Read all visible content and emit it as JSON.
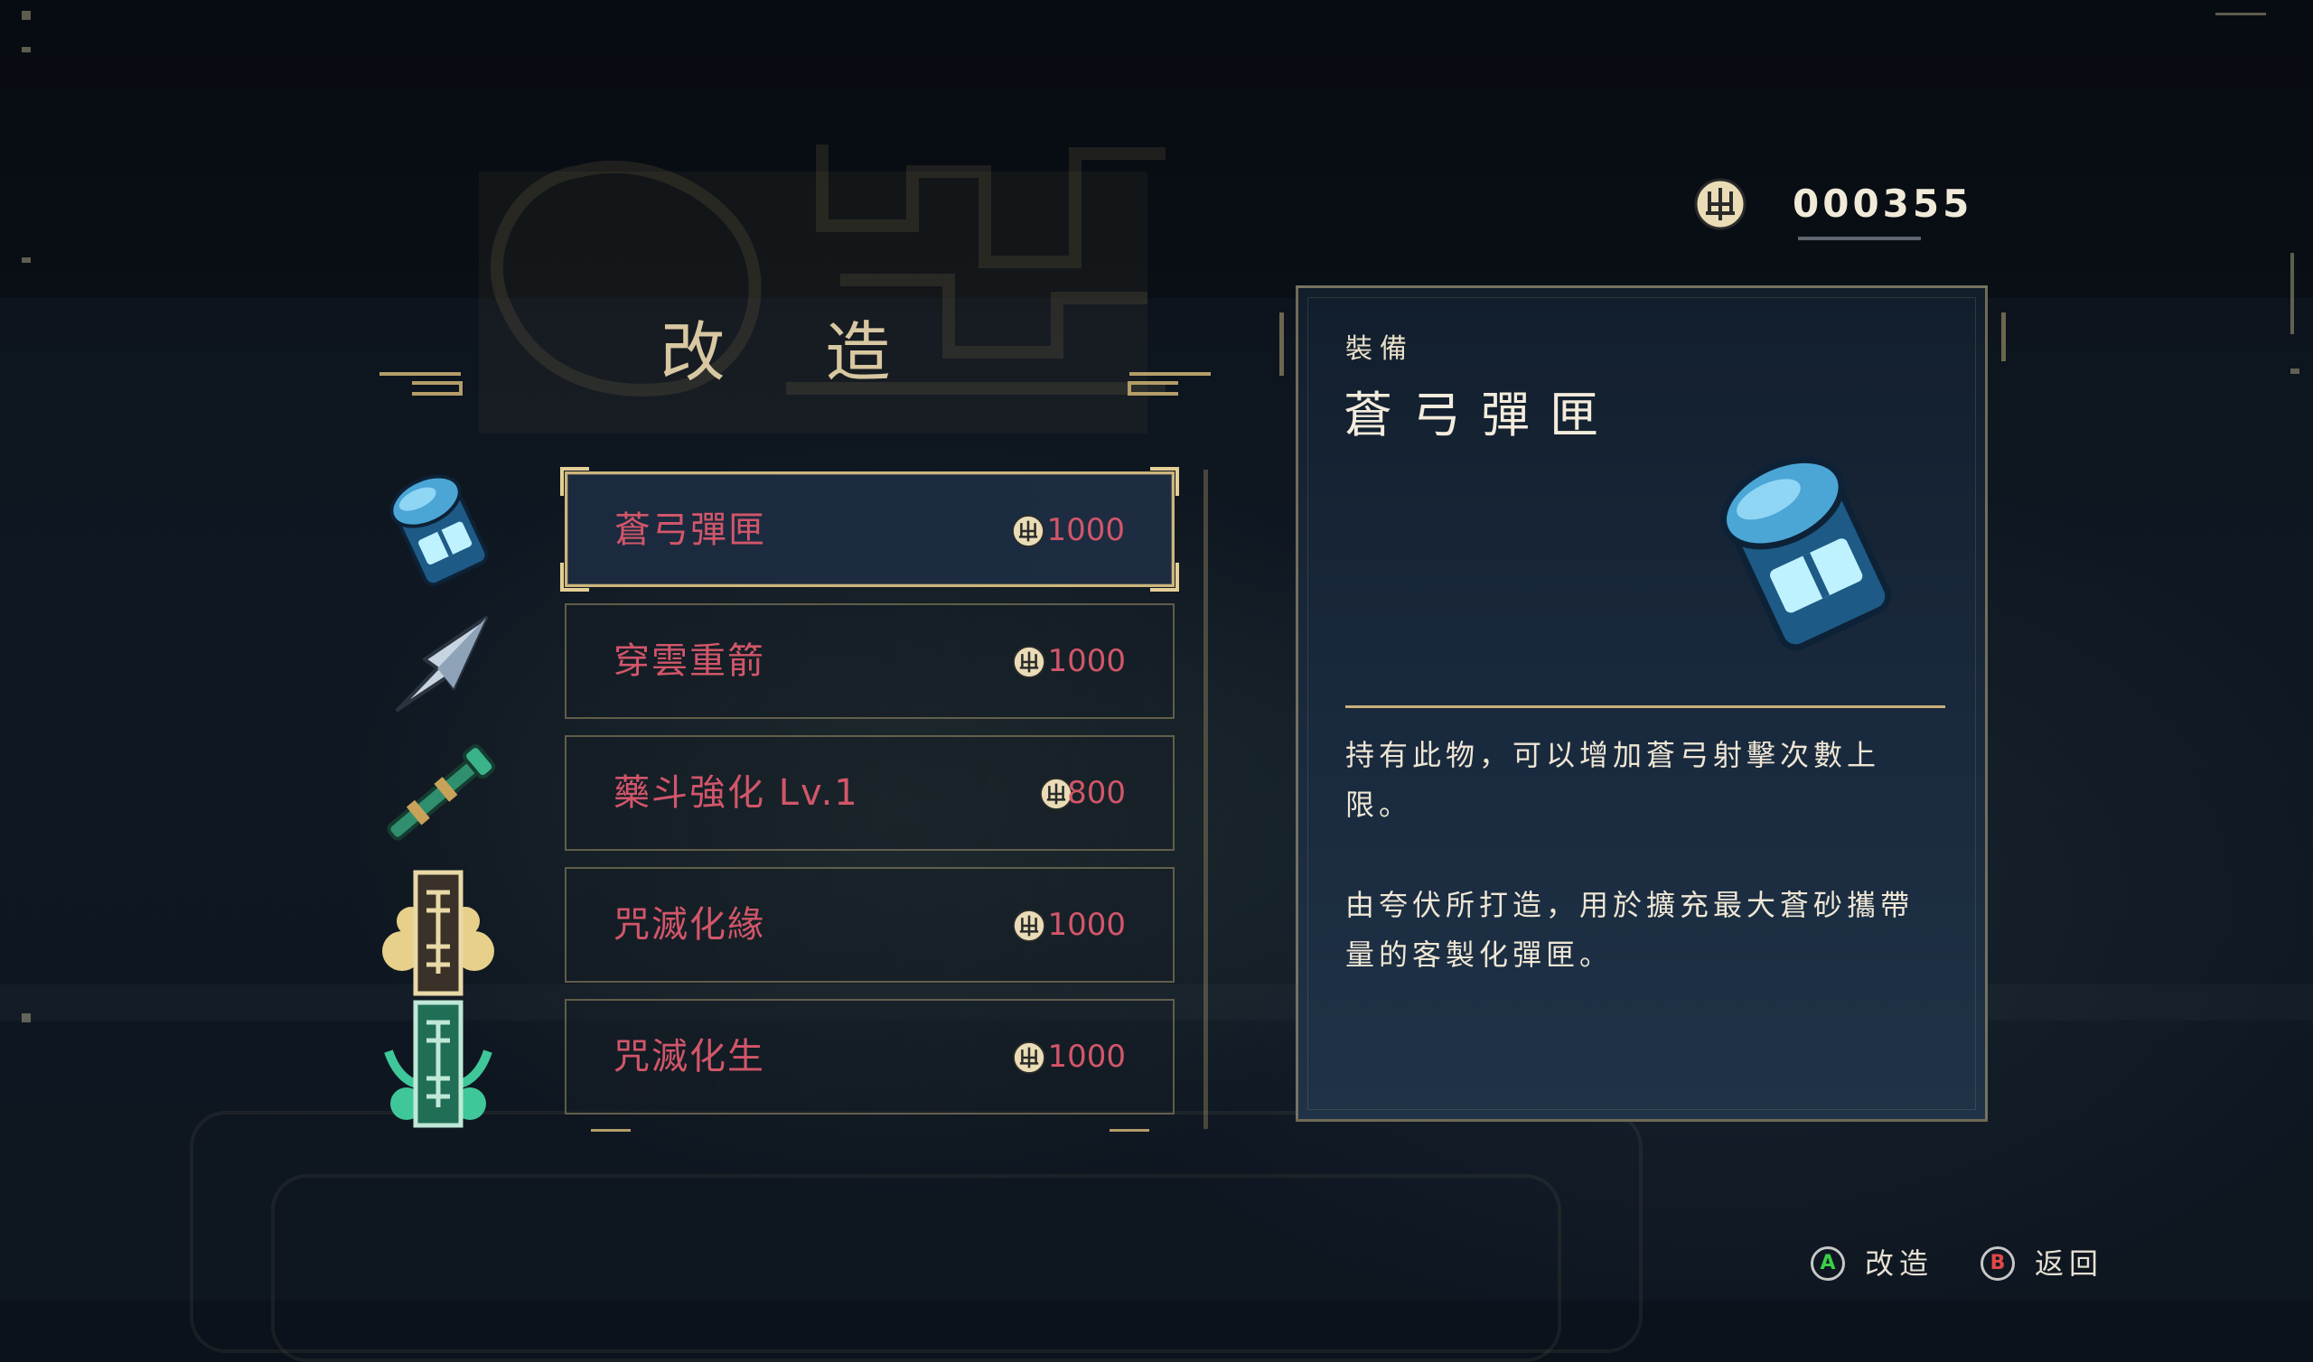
{
  "screen": {
    "title": "改 造",
    "currency": {
      "icon": "coin-icon",
      "amount": "000355"
    }
  },
  "items": [
    {
      "name": "蒼弓彈匣",
      "cost": "1000",
      "icon": "ammo-canister-icon",
      "selected": true
    },
    {
      "name": "穿雲重箭",
      "cost": "1000",
      "icon": "arrowhead-icon",
      "selected": false
    },
    {
      "name": "藥斗強化 Lv.1",
      "cost": "800",
      "icon": "medicine-pipe-icon",
      "selected": false
    },
    {
      "name": "咒滅化緣",
      "cost": "1000",
      "icon": "gold-talisman-icon",
      "selected": false
    },
    {
      "name": "咒滅化生",
      "cost": "1000",
      "icon": "jade-talisman-icon",
      "selected": false
    }
  ],
  "detail": {
    "category": "裝備",
    "title": "蒼弓彈匣",
    "image": "ammo-canister-icon",
    "description_1": "持有此物，可以增加蒼弓射擊次數上限。",
    "description_2": "由夸伏所打造，用於擴充最大蒼砂攜帶量的客製化彈匣。"
  },
  "prompts": [
    {
      "button": "A",
      "label": "改造"
    },
    {
      "button": "B",
      "label": "返回"
    }
  ],
  "colors": {
    "accent_gold": "#cdb57c",
    "unaffordable_red": "#d2566a",
    "panel_blue": "#1a2a3e",
    "button_a": "#3ccf4a",
    "button_b": "#e14848"
  }
}
